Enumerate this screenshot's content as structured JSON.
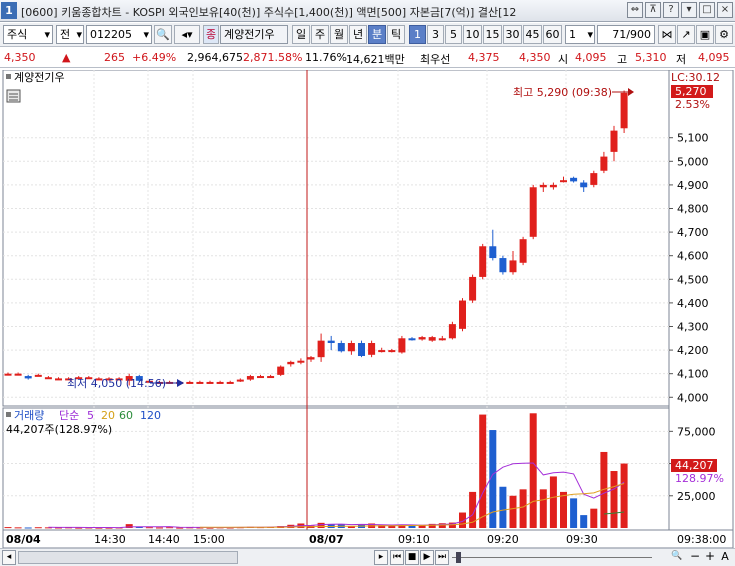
{
  "titlebar": {
    "window_number": "1",
    "title": "[0600] 키움종합차트 - KOSPI 외국인보유[40(천)] 주식수[1,400(천)] 액면[500] 자본금[7(억)] 결산[12"
  },
  "toolbar": {
    "market": "주식",
    "mode": "전",
    "code": "012205",
    "stock_name": "계양전기우",
    "periods": [
      "일",
      "주",
      "월",
      "년",
      "분",
      "틱"
    ],
    "active_period": "분",
    "intervals": [
      "1",
      "3",
      "5",
      "10",
      "15",
      "30",
      "45",
      "60"
    ],
    "active_interval": "1",
    "unit_value": "1",
    "count": "71/900"
  },
  "pricebar": {
    "price": "4,350",
    "change": "265",
    "change_pct": "+6.49%",
    "volume": "2,964,675",
    "volume_pct": "2,871.58%",
    "turnover": "11.76%",
    "amount": "14,621백만",
    "best_label": "최우선",
    "best_ask": "4,375",
    "best_bid": "4,350",
    "open_label": "시",
    "open": "4,095",
    "high_label": "고",
    "high": "5,310",
    "low_label": "저",
    "low": "4,095"
  },
  "price_panel": {
    "legend": "계양전기우",
    "lc_label": "LC:30.12",
    "last_price_tag": "5,270",
    "last_pct_tag": "2.53%",
    "high_annotation": "최고 5,290 (09:38)",
    "low_annotation": "최저 4,050 (14:56)"
  },
  "volume_panel": {
    "legend_title": "거래량",
    "legend_ma": "단순",
    "ma_periods": [
      "5",
      "20",
      "60",
      "120"
    ],
    "current_volume": "44,207주(128.97%)",
    "tag_volume": "44,207",
    "tag_pct": "128.97%"
  },
  "chart_data": {
    "type": "candlestick",
    "price_axis": {
      "ylim": [
        3980,
        5370
      ],
      "ticks": [
        "5,100",
        "5,000",
        "4,900",
        "4,800",
        "4,700",
        "4,600",
        "4,500",
        "4,400",
        "4,300",
        "4,200",
        "4,100",
        "4,000"
      ]
    },
    "volume_axis": {
      "ylim": [
        0,
        90000
      ],
      "ticks": [
        "75,000",
        "50,000",
        "25,000"
      ]
    },
    "x_ticks": [
      "08/04",
      "14:30",
      "14:40",
      "15:00",
      "08/07",
      "09:10",
      "09:20",
      "09:30",
      "09:38:00"
    ],
    "candles": [
      {
        "o": 4100,
        "h": 4105,
        "l": 4095,
        "c": 4100
      },
      {
        "o": 4100,
        "h": 4105,
        "l": 4095,
        "c": 4100
      },
      {
        "o": 4090,
        "h": 4095,
        "l": 4075,
        "c": 4080
      },
      {
        "o": 4095,
        "h": 4100,
        "l": 4090,
        "c": 4095
      },
      {
        "o": 4085,
        "h": 4090,
        "l": 4080,
        "c": 4085
      },
      {
        "o": 4080,
        "h": 4085,
        "l": 4075,
        "c": 4080
      },
      {
        "o": 4080,
        "h": 4085,
        "l": 4075,
        "c": 4080
      },
      {
        "o": 4085,
        "h": 4090,
        "l": 4080,
        "c": 4085
      },
      {
        "o": 4085,
        "h": 4090,
        "l": 4080,
        "c": 4085
      },
      {
        "o": 4080,
        "h": 4085,
        "l": 4075,
        "c": 4080
      },
      {
        "o": 4080,
        "h": 4085,
        "l": 4075,
        "c": 4080
      },
      {
        "o": 4080,
        "h": 4085,
        "l": 4075,
        "c": 4080
      },
      {
        "o": 4070,
        "h": 4100,
        "l": 4050,
        "c": 4090
      },
      {
        "o": 4090,
        "h": 4095,
        "l": 4065,
        "c": 4070
      },
      {
        "o": 4070,
        "h": 4075,
        "l": 4065,
        "c": 4070
      },
      {
        "o": 4065,
        "h": 4070,
        "l": 4060,
        "c": 4065
      },
      {
        "o": 4065,
        "h": 4070,
        "l": 4060,
        "c": 4065
      },
      {
        "o": 4065,
        "h": 4070,
        "l": 4060,
        "c": 4065
      },
      {
        "o": 4065,
        "h": 4070,
        "l": 4060,
        "c": 4065
      },
      {
        "o": 4065,
        "h": 4070,
        "l": 4060,
        "c": 4065
      },
      {
        "o": 4065,
        "h": 4070,
        "l": 4060,
        "c": 4065
      },
      {
        "o": 4065,
        "h": 4070,
        "l": 4060,
        "c": 4065
      },
      {
        "o": 4065,
        "h": 4070,
        "l": 4060,
        "c": 4065
      },
      {
        "o": 4070,
        "h": 4080,
        "l": 4065,
        "c": 4075
      },
      {
        "o": 4075,
        "h": 4095,
        "l": 4070,
        "c": 4090
      },
      {
        "o": 4090,
        "h": 4095,
        "l": 4085,
        "c": 4090
      },
      {
        "o": 4090,
        "h": 4095,
        "l": 4085,
        "c": 4090
      },
      {
        "o": 4095,
        "h": 4135,
        "l": 4090,
        "c": 4130
      },
      {
        "o": 4140,
        "h": 4155,
        "l": 4130,
        "c": 4150
      },
      {
        "o": 4150,
        "h": 4165,
        "l": 4140,
        "c": 4155
      },
      {
        "o": 4160,
        "h": 4175,
        "l": 4150,
        "c": 4170
      },
      {
        "o": 4170,
        "h": 4270,
        "l": 4150,
        "c": 4240
      },
      {
        "o": 4240,
        "h": 4260,
        "l": 4200,
        "c": 4230
      },
      {
        "o": 4230,
        "h": 4240,
        "l": 4190,
        "c": 4195
      },
      {
        "o": 4195,
        "h": 4240,
        "l": 4180,
        "c": 4230
      },
      {
        "o": 4230,
        "h": 4240,
        "l": 4170,
        "c": 4175
      },
      {
        "o": 4180,
        "h": 4240,
        "l": 4170,
        "c": 4230
      },
      {
        "o": 4200,
        "h": 4210,
        "l": 4190,
        "c": 4200
      },
      {
        "o": 4195,
        "h": 4205,
        "l": 4190,
        "c": 4200
      },
      {
        "o": 4190,
        "h": 4260,
        "l": 4185,
        "c": 4250
      },
      {
        "o": 4250,
        "h": 4255,
        "l": 4240,
        "c": 4245
      },
      {
        "o": 4245,
        "h": 4260,
        "l": 4240,
        "c": 4255
      },
      {
        "o": 4240,
        "h": 4260,
        "l": 4235,
        "c": 4255
      },
      {
        "o": 4245,
        "h": 4260,
        "l": 4240,
        "c": 4250
      },
      {
        "o": 4250,
        "h": 4320,
        "l": 4245,
        "c": 4310
      },
      {
        "o": 4290,
        "h": 4420,
        "l": 4280,
        "c": 4410
      },
      {
        "o": 4410,
        "h": 4520,
        "l": 4400,
        "c": 4510
      },
      {
        "o": 4510,
        "h": 4650,
        "l": 4500,
        "c": 4640
      },
      {
        "o": 4640,
        "h": 4710,
        "l": 4580,
        "c": 4590
      },
      {
        "o": 4590,
        "h": 4600,
        "l": 4520,
        "c": 4530
      },
      {
        "o": 4530,
        "h": 4620,
        "l": 4520,
        "c": 4580
      },
      {
        "o": 4570,
        "h": 4680,
        "l": 4560,
        "c": 4670
      },
      {
        "o": 4680,
        "h": 4900,
        "l": 4670,
        "c": 4890
      },
      {
        "o": 4890,
        "h": 4910,
        "l": 4870,
        "c": 4900
      },
      {
        "o": 4890,
        "h": 4910,
        "l": 4880,
        "c": 4900
      },
      {
        "o": 4920,
        "h": 4935,
        "l": 4910,
        "c": 4920
      },
      {
        "o": 4930,
        "h": 4935,
        "l": 4910,
        "c": 4915
      },
      {
        "o": 4910,
        "h": 4920,
        "l": 4870,
        "c": 4890
      },
      {
        "o": 4900,
        "h": 4960,
        "l": 4890,
        "c": 4950
      },
      {
        "o": 4960,
        "h": 5040,
        "l": 4950,
        "c": 5020
      },
      {
        "o": 5040,
        "h": 5150,
        "l": 5000,
        "c": 5130
      },
      {
        "o": 5140,
        "h": 5300,
        "l": 5120,
        "c": 5290
      }
    ],
    "volumes": [
      700,
      500,
      400,
      600,
      500,
      400,
      500,
      300,
      400,
      300,
      300,
      400,
      3000,
      800,
      600,
      400,
      600,
      300,
      500,
      400,
      300,
      500,
      400,
      600,
      900,
      700,
      800,
      1500,
      2500,
      3500,
      1800,
      4000,
      2800,
      3000,
      1500,
      2600,
      3500,
      2200,
      1800,
      2500,
      2000,
      2400,
      3200,
      3700,
      4200,
      12000,
      28000,
      88000,
      76000,
      32000,
      25000,
      30000,
      89000,
      30000,
      40000,
      28000,
      23000,
      10000,
      15000,
      59000,
      44207,
      50000
    ]
  }
}
